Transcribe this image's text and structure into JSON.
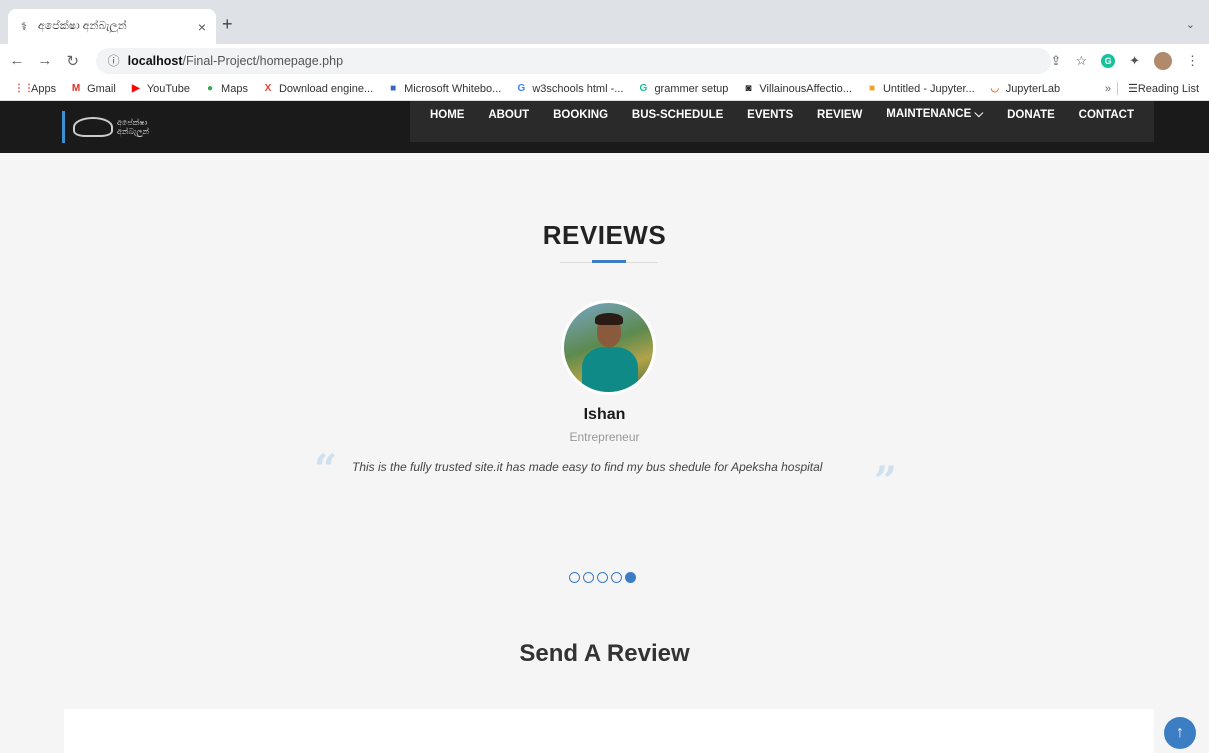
{
  "browser": {
    "tab_title": "අපේක්ෂා අන්බැලුන්",
    "tab_close": "×",
    "new_tab": "+",
    "tab_menu": "⌄",
    "url_host": "localhost",
    "url_path": "/Final-Project/homepage.php",
    "bookmarks": [
      {
        "label": "Apps",
        "icon": "apps-icon",
        "glyph": "⋮⋮",
        "color": "#e8453c"
      },
      {
        "label": "Gmail",
        "icon": "gmail-icon",
        "glyph": "M",
        "color": "#d93025"
      },
      {
        "label": "YouTube",
        "icon": "youtube-icon",
        "glyph": "▶",
        "color": "#ff0000"
      },
      {
        "label": "Maps",
        "icon": "maps-icon",
        "glyph": "●",
        "color": "#34a853"
      },
      {
        "label": "Download engine...",
        "icon": "download-engine-icon",
        "glyph": "X",
        "color": "#e8453c"
      },
      {
        "label": "Microsoft Whitebo...",
        "icon": "whiteboard-icon",
        "glyph": "■",
        "color": "#3567c6"
      },
      {
        "label": "w3schools html -...",
        "icon": "google-icon",
        "glyph": "G",
        "color": "#4285f4"
      },
      {
        "label": "grammer setup",
        "icon": "grammarly-icon",
        "glyph": "G",
        "color": "#15c39a"
      },
      {
        "label": "VillainousAffectio...",
        "icon": "villainous-icon",
        "glyph": "◙",
        "color": "#222222"
      },
      {
        "label": "Untitled - Jupyter...",
        "icon": "jupyter-notebook-icon",
        "glyph": "■",
        "color": "#f0a030"
      },
      {
        "label": "JupyterLab",
        "icon": "jupyterlab-icon",
        "glyph": "◡",
        "color": "#f37726"
      }
    ],
    "more_bookmarks": "»",
    "reading_list": "Reading List"
  },
  "nav": {
    "items": [
      "HOME",
      "ABOUT",
      "BOOKING",
      "BUS-SCHEDULE",
      "EVENTS",
      "REVIEW",
      "MAINTENANCE ⌵",
      "DONATE",
      "CONTACT"
    ]
  },
  "logo_text": "අපේක්ෂා\nඅන්බැලුන්",
  "reviews": {
    "title": "REVIEWS",
    "name": "Ishan",
    "role": "Entrepreneur",
    "quote_open": "“",
    "quote_close": "”",
    "text": "This is the fully trusted site.it has made easy to find my bus shedule for Apeksha hospital",
    "slide_count": 5,
    "active_slide": 5
  },
  "send_review": {
    "title": "Send A Review"
  },
  "to_top": "↑",
  "colors": {
    "accent": "#3d7dc4",
    "header_bg": "#1a1a1a"
  }
}
